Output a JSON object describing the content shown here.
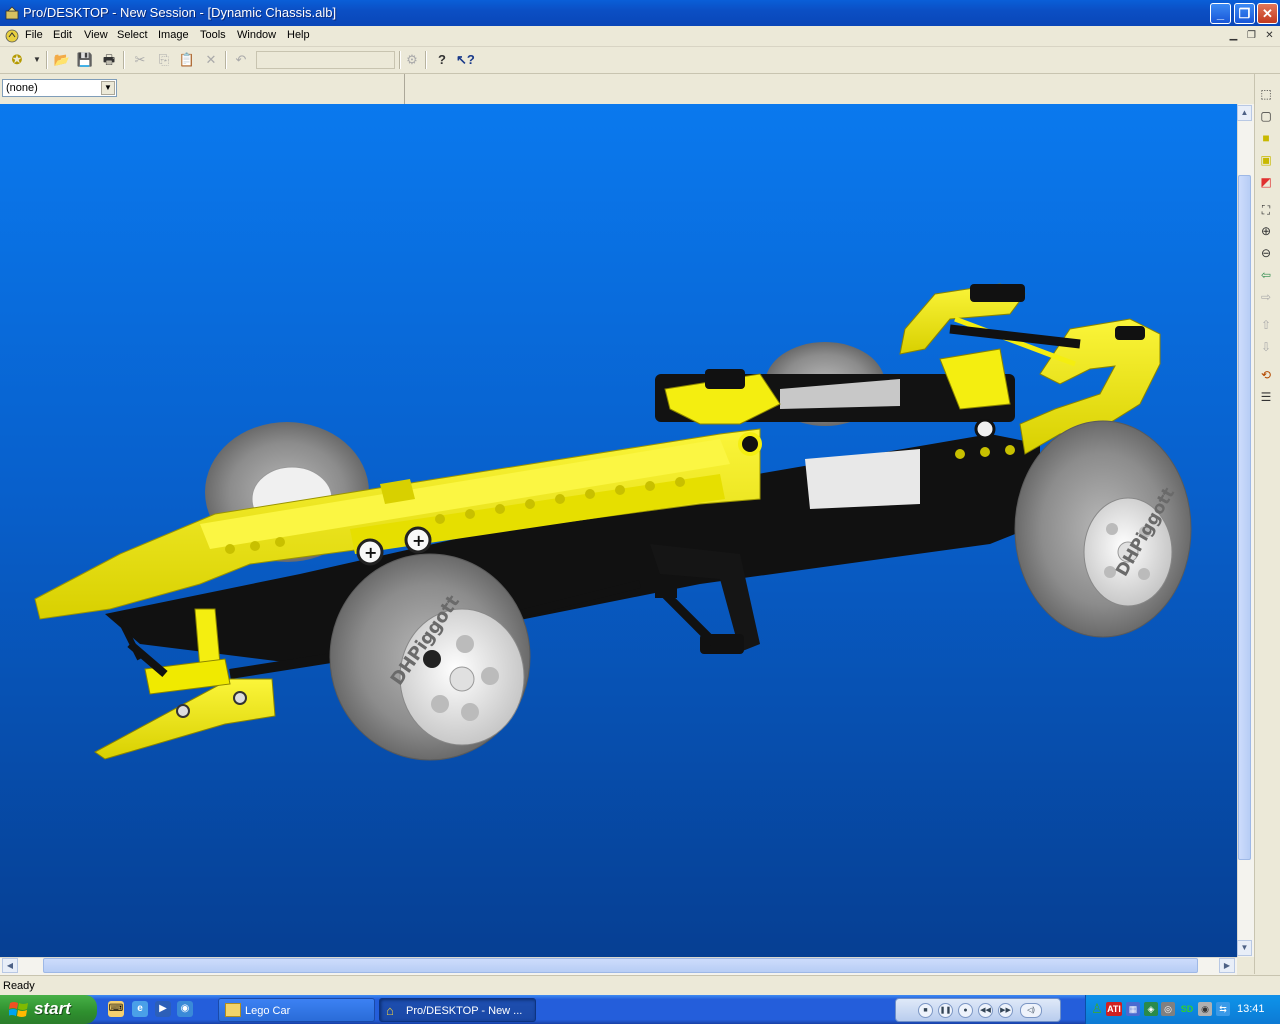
{
  "window": {
    "title": "Pro/DESKTOP - New Session - [Dynamic Chassis.alb]",
    "minimize": "_",
    "maximize": "❐",
    "close": "✕"
  },
  "menu": {
    "items": [
      "File",
      "Edit",
      "View",
      "Select",
      "Image",
      "Tools",
      "Window",
      "Help"
    ]
  },
  "toolbar2": {
    "combo_value": "(none)"
  },
  "model": {
    "tire_text": "DHPiggott"
  },
  "status": {
    "text": "Ready"
  },
  "taskbar": {
    "start_label": "start",
    "buttons": [
      {
        "label": "Lego Car",
        "icon": "folder-icon"
      },
      {
        "label": "Pro/DESKTOP - New ...",
        "icon": "prodesktop-icon",
        "active": true
      }
    ],
    "tray_ati": "ATI",
    "tray_sd": "SD",
    "clock": "13:41"
  },
  "colors": {
    "viewport_top": "#0a79ee",
    "viewport_bottom": "#063f93",
    "model_yellow": "#f4f00c",
    "model_black": "#111111",
    "tire_gray": "#8a8a8a",
    "title_bar": "#0b4fc4",
    "taskbar": "#245edb",
    "start_green": "#3c9c3c"
  }
}
